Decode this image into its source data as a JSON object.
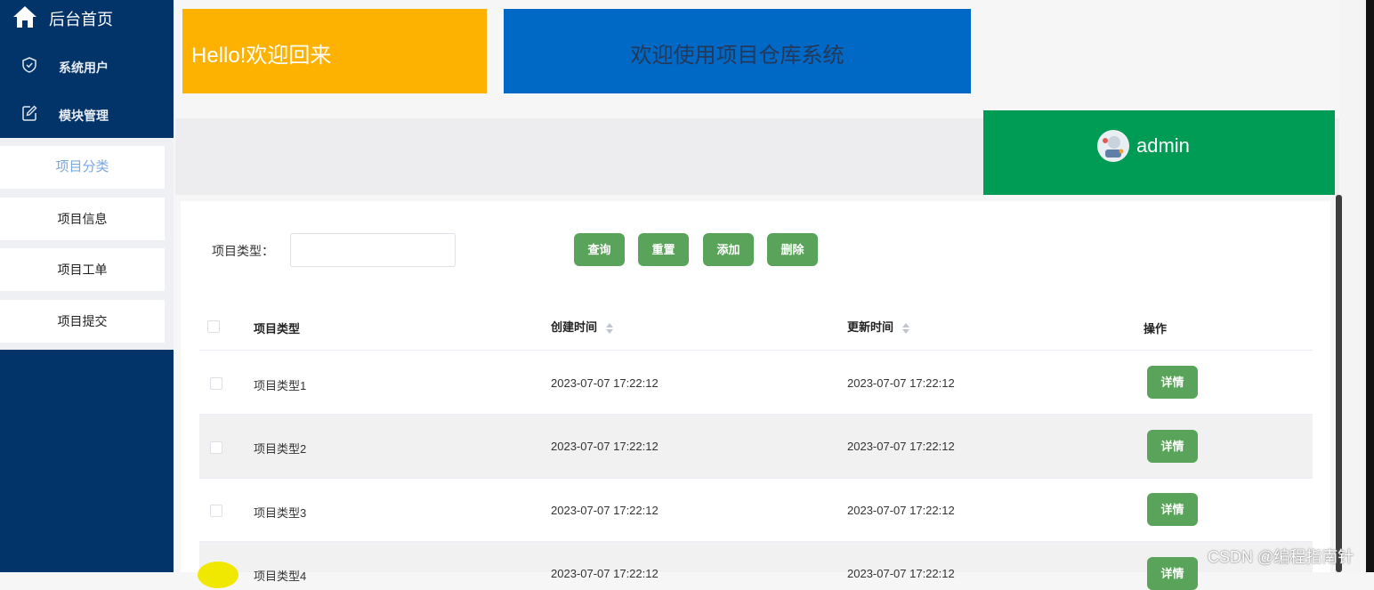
{
  "sidebar": {
    "home_label": "后台首页",
    "menu": [
      {
        "label": "系统用户",
        "icon": "shield-icon"
      },
      {
        "label": "模块管理",
        "icon": "edit-icon"
      }
    ],
    "sub_items": [
      {
        "label": "项目分类",
        "active": true
      },
      {
        "label": "项目信息",
        "active": false
      },
      {
        "label": "项目工单",
        "active": false
      },
      {
        "label": "项目提交",
        "active": false
      }
    ]
  },
  "header": {
    "welcome_text": "Hello!欢迎回来",
    "system_title": "欢迎使用项目仓库系统",
    "username": "admin"
  },
  "search": {
    "label": "项目类型：",
    "value": "",
    "placeholder": ""
  },
  "buttons": {
    "query": "查询",
    "reset": "重置",
    "add": "添加",
    "delete": "删除"
  },
  "table": {
    "columns": [
      "项目类型",
      "创建时间",
      "更新时间",
      "操作"
    ],
    "rows": [
      {
        "type": "项目类型1",
        "created": "2023-07-07 17:22:12",
        "updated": "2023-07-07 17:22:12",
        "action": "详情"
      },
      {
        "type": "项目类型2",
        "created": "2023-07-07 17:22:12",
        "updated": "2023-07-07 17:22:12",
        "action": "详情"
      },
      {
        "type": "项目类型3",
        "created": "2023-07-07 17:22:12",
        "updated": "2023-07-07 17:22:12",
        "action": "详情"
      },
      {
        "type": "项目类型4",
        "created": "2023-07-07 17:22:12",
        "updated": "2023-07-07 17:22:12",
        "action": "详情"
      }
    ]
  },
  "watermark": "CSDN @编程指南针",
  "colors": {
    "sidebar": "#033469",
    "orange_banner": "#fdb100",
    "blue_banner": "#0068c5",
    "user_box": "#009b55",
    "button": "#5aa35a"
  }
}
